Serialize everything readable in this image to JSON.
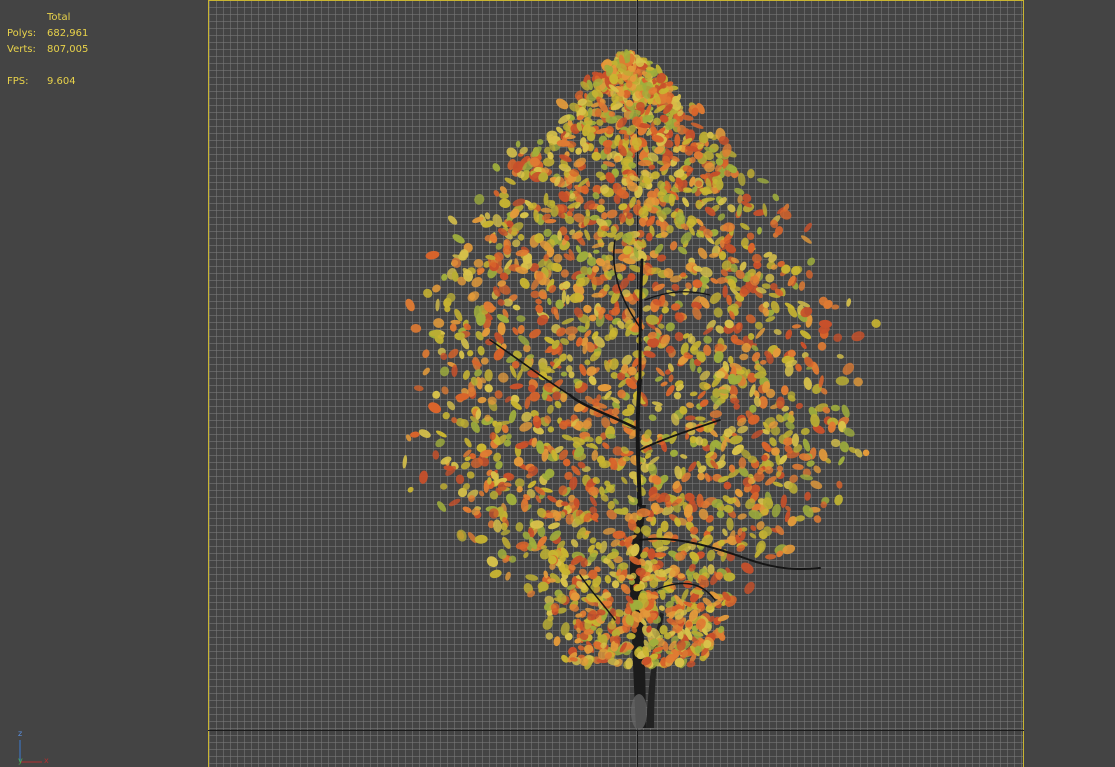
{
  "stats": {
    "header": "Total",
    "polys_label": "Polys:",
    "polys_value": "682,961",
    "verts_label": "Verts:",
    "verts_value": "807,005",
    "fps_label": "FPS:",
    "fps_value": "9.604"
  },
  "gizmo": {
    "z": "z",
    "y": "y",
    "x": "x"
  },
  "colors": {
    "background": "#444444",
    "grid": "#7a7a7a",
    "safe_frame": "#c9b531",
    "stats_text": "#e8d24a",
    "foliage_orange": "#d96a2c",
    "foliage_yellow": "#c9b531",
    "foliage_green": "#9aa83a",
    "trunk": "#1a1a1a"
  },
  "icons": [
    "axis-gizmo-icon",
    "tree-model-icon"
  ]
}
